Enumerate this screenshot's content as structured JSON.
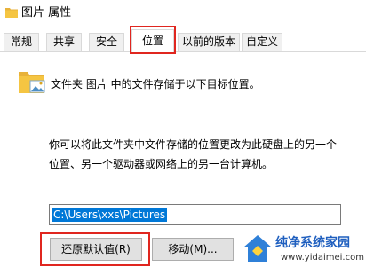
{
  "window": {
    "title": "图片 属性",
    "icon": "folder-icon"
  },
  "tabs": [
    {
      "label": "常规",
      "active": false
    },
    {
      "label": "共享",
      "active": false
    },
    {
      "label": "安全",
      "active": false
    },
    {
      "label": "位置",
      "active": true
    },
    {
      "label": "以前的版本",
      "active": false
    },
    {
      "label": "自定义",
      "active": false
    }
  ],
  "location": {
    "summary": "文件夹 图片 中的文件存储于以下目标位置。",
    "description": "你可以将此文件夹中文件存储的位置更改为此硬盘上的另一个位置、另一个驱动器或网络上的另一台计算机。",
    "path_value": "C:\\Users\\xxs\\Pictures"
  },
  "buttons": {
    "restore_default": "还原默认值(R)",
    "move": "移动(M)..."
  },
  "watermark": {
    "text": "纯净系统家园",
    "url": "www.yidaimei.com"
  },
  "colors": {
    "highlight": "#e0261f",
    "selection": "#0078d7",
    "folder": "#f5c542"
  }
}
